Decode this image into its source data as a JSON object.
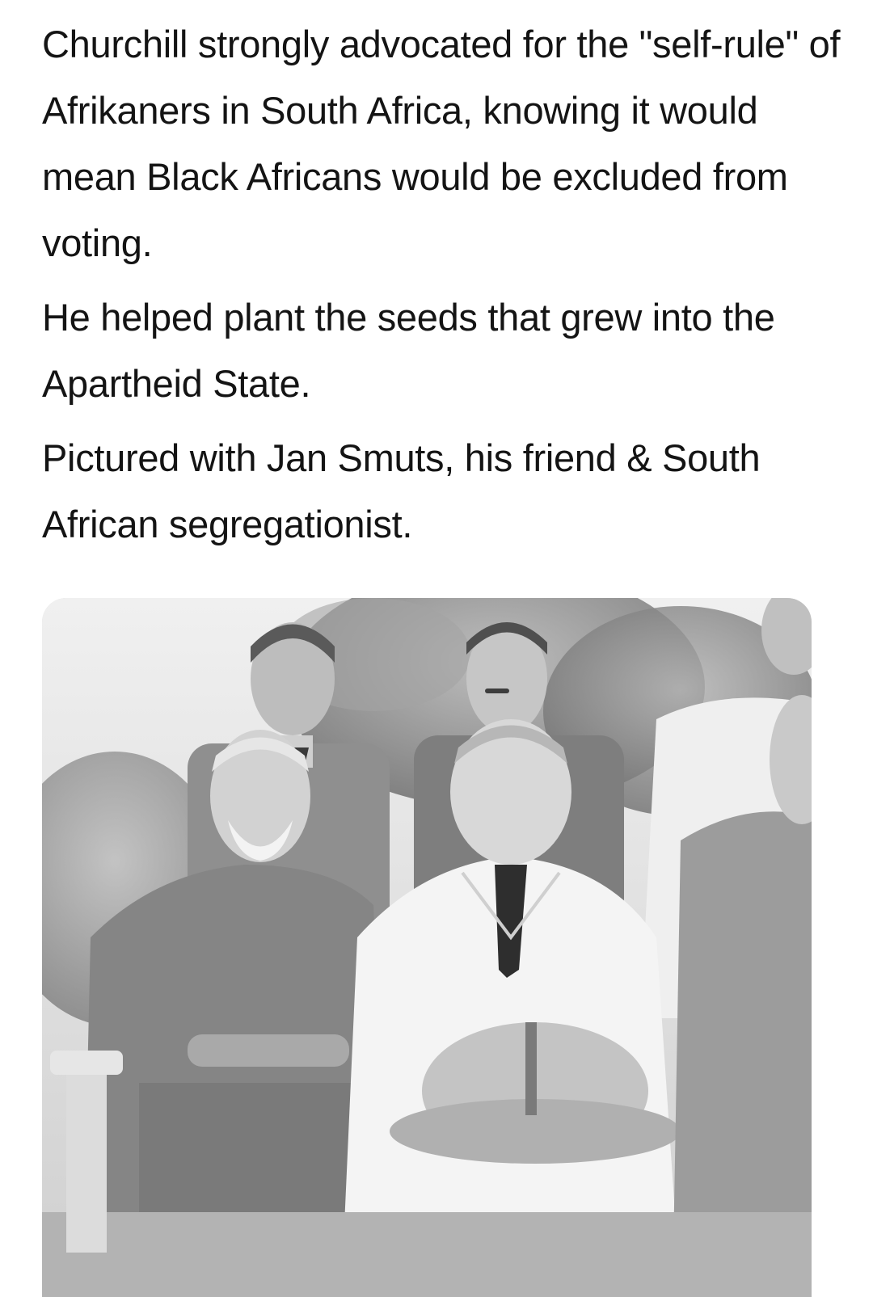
{
  "tweet": {
    "paragraphs": [
      "Churchill strongly advocated for the \"self-rule\" of Afrikaners in South Africa, knowing it would mean Black Africans would be excluded from voting.",
      "He helped plant the seeds that grew into the Apartheid State.",
      "Pictured with Jan Smuts, his friend & South African segregationist."
    ]
  },
  "photo": {
    "description_icon": "black-and-white-group-photo",
    "palette": {
      "sky": "#e6e6e6",
      "foliage": "#9a9a9a",
      "uniform": "#8a8a8a",
      "white_suit": "#f2f2f2",
      "shadow": "#4a4a4a"
    }
  }
}
